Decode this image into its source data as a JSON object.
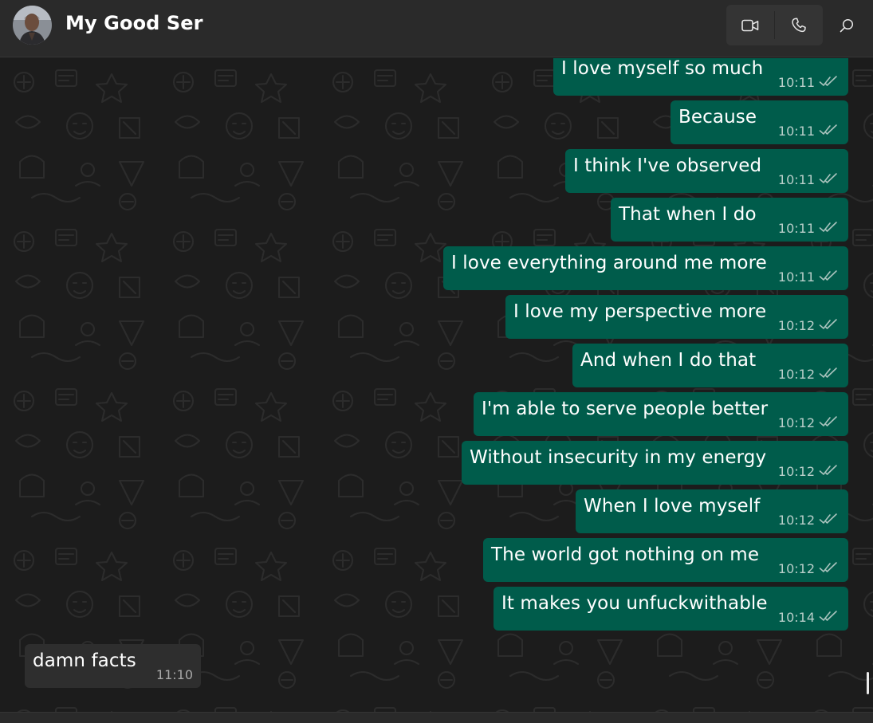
{
  "header": {
    "contact_name": "My Good Ser",
    "video_call_icon": "video-camera-icon",
    "voice_call_icon": "phone-icon",
    "search_icon": "search-icon"
  },
  "colors": {
    "header_bg": "#2a2a2a",
    "chat_bg": "#1c1c1c",
    "outgoing_bubble": "#005c4b",
    "incoming_bubble": "#2e2e2e"
  },
  "messages": [
    {
      "direction": "out",
      "text": "I love myself so much",
      "time": "10:11",
      "status": "read"
    },
    {
      "direction": "out",
      "text": "Because",
      "time": "10:11",
      "status": "read"
    },
    {
      "direction": "out",
      "text": "I think I've observed",
      "time": "10:11",
      "status": "read"
    },
    {
      "direction": "out",
      "text": "That when I do",
      "time": "10:11",
      "status": "read"
    },
    {
      "direction": "out",
      "text": "I love everything around me more",
      "time": "10:11",
      "status": "read"
    },
    {
      "direction": "out",
      "text": "I love my perspective more",
      "time": "10:12",
      "status": "read"
    },
    {
      "direction": "out",
      "text": "And when I do that",
      "time": "10:12",
      "status": "read"
    },
    {
      "direction": "out",
      "text": "I'm able to serve people better",
      "time": "10:12",
      "status": "read"
    },
    {
      "direction": "out",
      "text": "Without insecurity in my energy",
      "time": "10:12",
      "status": "read"
    },
    {
      "direction": "out",
      "text": "When I love myself",
      "time": "10:12",
      "status": "read"
    },
    {
      "direction": "out",
      "text": "The world got nothing on me",
      "time": "10:12",
      "status": "read"
    },
    {
      "direction": "out",
      "text": "It makes you unfuckwithable",
      "time": "10:14",
      "status": "read"
    },
    {
      "direction": "in",
      "text": "damn facts",
      "time": "11:10"
    }
  ]
}
